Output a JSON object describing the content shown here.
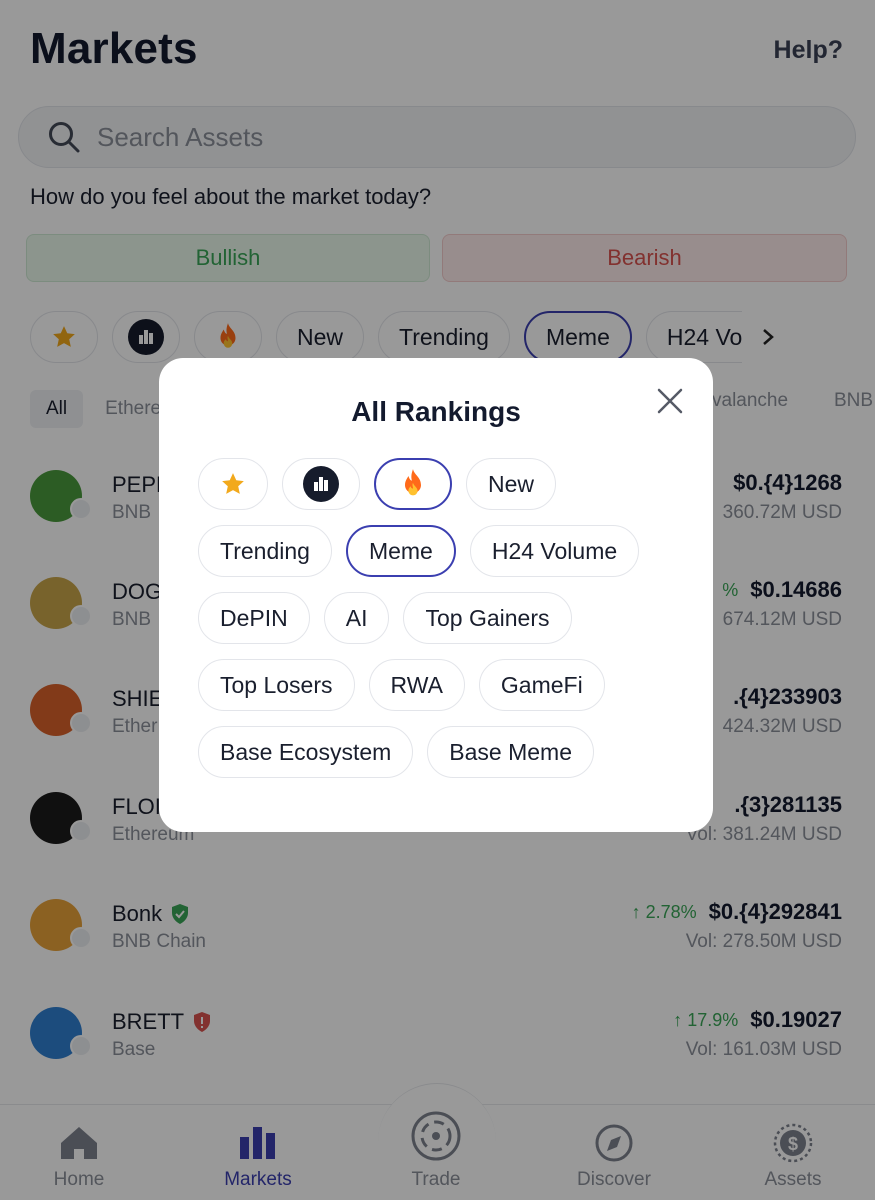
{
  "header": {
    "title": "Markets",
    "help": "Help?"
  },
  "search": {
    "placeholder": "Search Assets"
  },
  "sentiment": {
    "question": "How do you feel about the market today?",
    "bullish": "Bullish",
    "bearish": "Bearish"
  },
  "filters": {
    "icons": [
      "star-icon",
      "rank-icon",
      "fire-icon"
    ],
    "labels": [
      "New",
      "Trending",
      "Meme",
      "H24 Vo"
    ],
    "active": "Meme"
  },
  "chains": {
    "all": "All",
    "eth_partial": "Ethere",
    "avax_partial": "valanche",
    "bnb_partial": "BNB"
  },
  "assets": [
    {
      "name": "PEPE",
      "chain": "BNB",
      "change": "",
      "price": "$0.{4}1268",
      "volume": "360.72M USD",
      "logo_color": "#4a9a3c"
    },
    {
      "name": "DOG",
      "chain": "BNB",
      "change": "%",
      "price": "$0.14686",
      "volume": "674.12M USD",
      "logo_color": "#c9a54a"
    },
    {
      "name": "SHIE",
      "chain": "Ether",
      "change": "",
      "price": ".{4}233903",
      "volume": "424.32M USD",
      "logo_color": "#d9622b"
    },
    {
      "name": "FLOI",
      "chain": "Ethereum",
      "change": "",
      "price": ".{3}281135",
      "volume": "Vol: 381.24M USD",
      "logo_color": "#1c1c1c"
    },
    {
      "name": "Bonk",
      "chain": "BNB Chain",
      "change": "↑ 2.78%",
      "price": "$0.{4}292841",
      "volume": "Vol: 278.50M USD",
      "logo_color": "#e8a23a"
    },
    {
      "name": "BRETT",
      "chain": "Base",
      "change": "↑ 17.9%",
      "price": "$0.19027",
      "volume": "Vol: 161.03M USD",
      "logo_color": "#2f7fd1"
    }
  ],
  "tabbar": {
    "home": "Home",
    "markets": "Markets",
    "trade": "Trade",
    "discover": "Discover",
    "assets": "Assets",
    "active": "Markets"
  },
  "modal": {
    "title": "All Rankings",
    "rows": [
      [
        "star-icon",
        "rank-icon",
        "fire-icon",
        "New"
      ],
      [
        "Trending",
        "Meme",
        "H24 Volume"
      ],
      [
        "DePIN",
        "AI",
        "Top Gainers"
      ],
      [
        "Top Losers",
        "RWA",
        "GameFi"
      ],
      [
        "Base Ecosystem",
        "Base Meme"
      ]
    ],
    "chip_labels": {
      "new": "New",
      "trending": "Trending",
      "meme": "Meme",
      "h24": "H24 Volume",
      "depin": "DePIN",
      "ai": "AI",
      "top_gainers": "Top Gainers",
      "top_losers": "Top Losers",
      "rwa": "RWA",
      "gamefi": "GameFi",
      "base_ecosystem": "Base Ecosystem",
      "base_meme": "Base Meme"
    },
    "active": [
      "fire-icon",
      "Meme"
    ]
  },
  "colors": {
    "accent": "#3b3fb0",
    "positive": "#3aa657",
    "negative": "#d9534f",
    "text": "#131a2e",
    "muted": "#8b8f99"
  }
}
